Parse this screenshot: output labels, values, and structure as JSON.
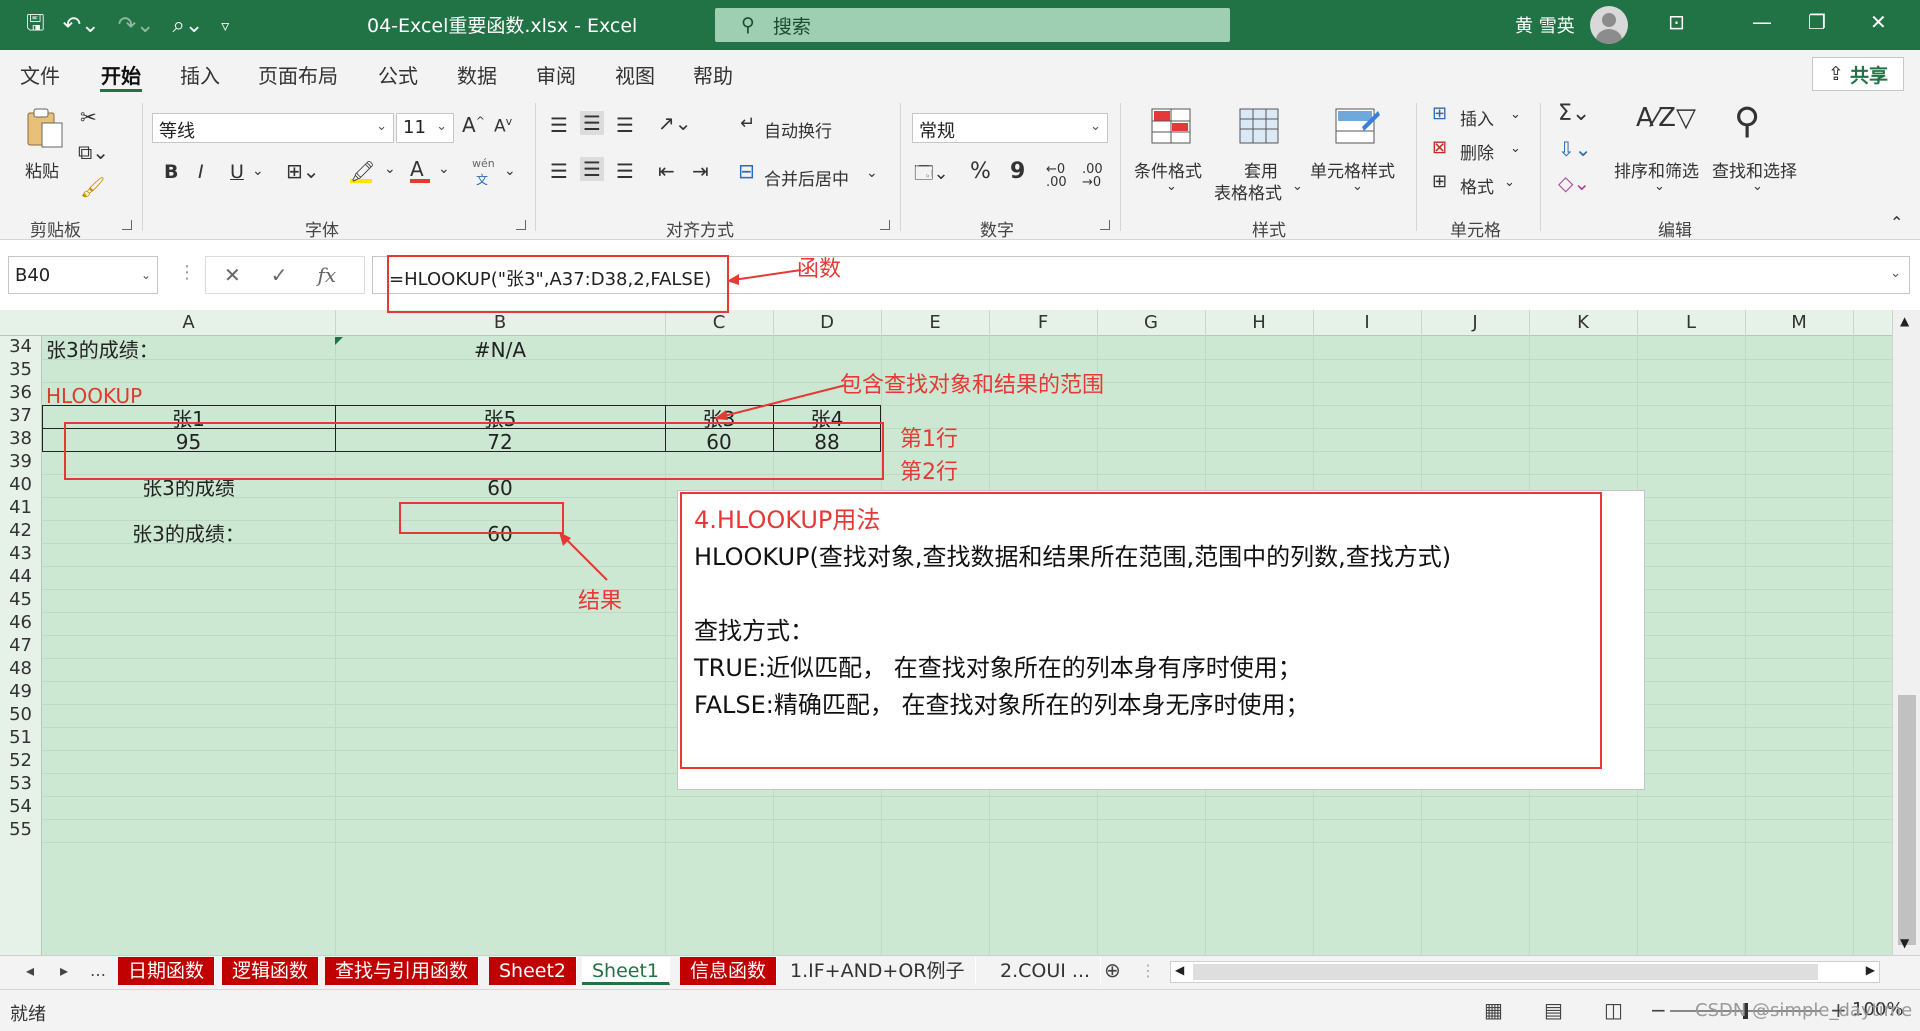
{
  "titlebar": {
    "doc_title": "04-Excel重要函数.xlsx  -  Excel",
    "search_placeholder": "搜索",
    "user_name": "黄 雪英"
  },
  "ribbon_tabs": [
    "文件",
    "开始",
    "插入",
    "页面布局",
    "公式",
    "数据",
    "审阅",
    "视图",
    "帮助"
  ],
  "share_label": "共享",
  "ribbon": {
    "clipboard": {
      "paste": "粘贴",
      "label": "剪贴板"
    },
    "font": {
      "name": "等线",
      "size": "11",
      "label": "字体",
      "bold": "B",
      "italic": "I",
      "underline": "U",
      "phonetic_top": "wén",
      "phonetic_bottom": "文"
    },
    "alignment": {
      "wrap": "自动换行",
      "merge": "合并后居中",
      "label": "对齐方式"
    },
    "number": {
      "format": "常规",
      "label": "数字",
      "percent": "%",
      "comma": "9"
    },
    "styles": {
      "conditional": "条件格式",
      "table_line1": "套用",
      "table_line2": "表格格式",
      "cell_styles": "单元格样式",
      "label": "样式"
    },
    "cells": {
      "insert": "插入",
      "delete": "删除",
      "format": "格式",
      "label": "单元格"
    },
    "editing": {
      "sort": "排序和筛选",
      "find": "查找和选择",
      "label": "编辑"
    }
  },
  "formula_bar": {
    "name_box": "B40",
    "formula": "=HLOOKUP(\"张3\",A37:D38,2,FALSE)",
    "fx": "fx"
  },
  "columns": [
    "A",
    "B",
    "C",
    "D",
    "E",
    "F",
    "G",
    "H",
    "I",
    "J",
    "K",
    "L",
    "M"
  ],
  "rows": [
    "34",
    "35",
    "36",
    "37",
    "38",
    "39",
    "40",
    "41",
    "42",
    "43",
    "44",
    "45",
    "46",
    "47",
    "48",
    "49",
    "50",
    "51",
    "52",
    "53",
    "54",
    "55"
  ],
  "cells": {
    "a34": "张3的成绩：",
    "b34": "#N/A",
    "a36": "HLOOKUP",
    "a37": "张1",
    "b37": "张5",
    "c37": "张3",
    "d37": "张4",
    "a38": "95",
    "b38": "72",
    "c38": "60",
    "d38": "88",
    "a40": "张3的成绩",
    "b40": "60",
    "a42": "张3的成绩：",
    "b42": "60"
  },
  "annotations": {
    "function": "函数",
    "range": "包含查找对象和结果的范围",
    "row1": "第1行",
    "row2": "第2行",
    "result": "结果"
  },
  "textbox": {
    "title": "4.HLOOKUP用法",
    "line1": "HLOOKUP(查找对象,查找数据和结果所在范围,范围中的列数,查找方式)",
    "line2": "查找方式：",
    "line3": "TRUE:近似匹配，  在查找对象所在的列本身有序时使用；",
    "line4": "FALSE:精确匹配，  在查找对象所在的列本身无序时使用；"
  },
  "sheet_tabs": [
    {
      "name": "日期函数",
      "style": "red"
    },
    {
      "name": "逻辑函数",
      "style": "red"
    },
    {
      "name": "查找与引用函数",
      "style": "red"
    },
    {
      "name": "Sheet2",
      "style": "red"
    },
    {
      "name": "Sheet1",
      "style": "active"
    },
    {
      "name": "信息函数",
      "style": "red"
    },
    {
      "name": "1.IF+AND+OR例子",
      "style": "plain"
    },
    {
      "name": "2.COUI ...",
      "style": "plain"
    }
  ],
  "status": {
    "text": "就绪",
    "zoom": "100%"
  },
  "watermark": "CSDN @simple_daytime",
  "colors": {
    "excel_green": "#217346",
    "grid_bg": "#cde8d2",
    "annotation_red": "#e53935",
    "tab_red": "#c00000"
  }
}
